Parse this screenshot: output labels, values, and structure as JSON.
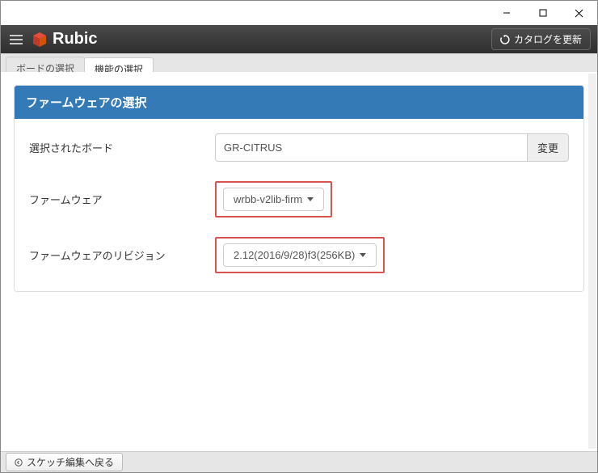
{
  "window": {
    "minimize": "—",
    "maximize": "□",
    "close": "✕"
  },
  "header": {
    "app_name": "Rubic",
    "refresh_label": "カタログを更新"
  },
  "tabs": {
    "board": "ボードの選択",
    "function": "機能の選択"
  },
  "panel": {
    "title": "ファームウェアの選択",
    "rows": {
      "board": {
        "label": "選択されたボード",
        "value": "GR-CITRUS",
        "change": "変更"
      },
      "firmware": {
        "label": "ファームウェア",
        "value": "wrbb-v2lib-firm"
      },
      "revision": {
        "label": "ファームウェアのリビジョン",
        "value": "2.12(2016/9/28)f3(256KB)"
      }
    }
  },
  "footer": {
    "back_label": "スケッチ編集へ戻る"
  }
}
